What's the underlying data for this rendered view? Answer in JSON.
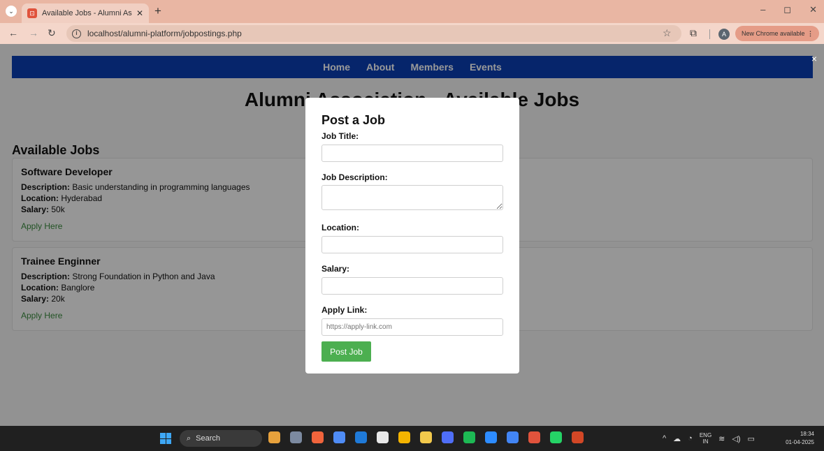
{
  "browser": {
    "tab_title": "Available Jobs - Alumni Associ",
    "tab_close": "✕",
    "new_tab": "+",
    "url": "localhost/alumni-platform/jobpostings.php",
    "profile_initial": "A",
    "update_label": "New Chrome available",
    "update_menu": "⋮",
    "win_min": "–",
    "win_max": "◻",
    "win_close": "✕"
  },
  "site": {
    "nav": [
      "Home",
      "About",
      "Members",
      "Events"
    ],
    "page_title": "Alumni Association - Available Jobs",
    "section_title": "Available Jobs",
    "overlay_close": "×"
  },
  "jobs": [
    {
      "title": "Software Developer",
      "description_label": "Description:",
      "description": " Basic understanding in programming languages",
      "location_label": "Location:",
      "location": " Hyderabad",
      "salary_label": "Salary:",
      "salary": " 50k",
      "apply": "Apply Here"
    },
    {
      "title": "Trainee Enginner",
      "description_label": "Description:",
      "description": " Strong Foundation in Python and Java",
      "location_label": "Location:",
      "location": " Banglore",
      "salary_label": "Salary:",
      "salary": " 20k",
      "apply": "Apply Here"
    }
  ],
  "modal": {
    "title": "Post a Job",
    "job_title_label": "Job Title:",
    "job_description_label": "Job Description:",
    "location_label": "Location:",
    "salary_label": "Salary:",
    "apply_link_label": "Apply Link:",
    "apply_link_placeholder": "https://apply-link.com",
    "submit_label": "Post Job"
  },
  "taskbar": {
    "search_label": "Search",
    "lang_line1": "ENG",
    "lang_line2": "IN",
    "time": "18:34",
    "date": "01-04-2025",
    "app_icon_colors": [
      "#e7a13c",
      "#7c8aa0",
      "#f0643c",
      "#4f8cf5",
      "#1f7ad8",
      "#e8e8e8",
      "#f4b400",
      "#f2c94c",
      "#4f6ef7",
      "#1db954",
      "#2d8cff",
      "#4285f4",
      "#e0533c",
      "#25d366",
      "#d24726"
    ]
  },
  "colors": {
    "nav_bg": "#0a3fb3",
    "button_green": "#4caf50",
    "link_green": "#3a8a3e"
  }
}
